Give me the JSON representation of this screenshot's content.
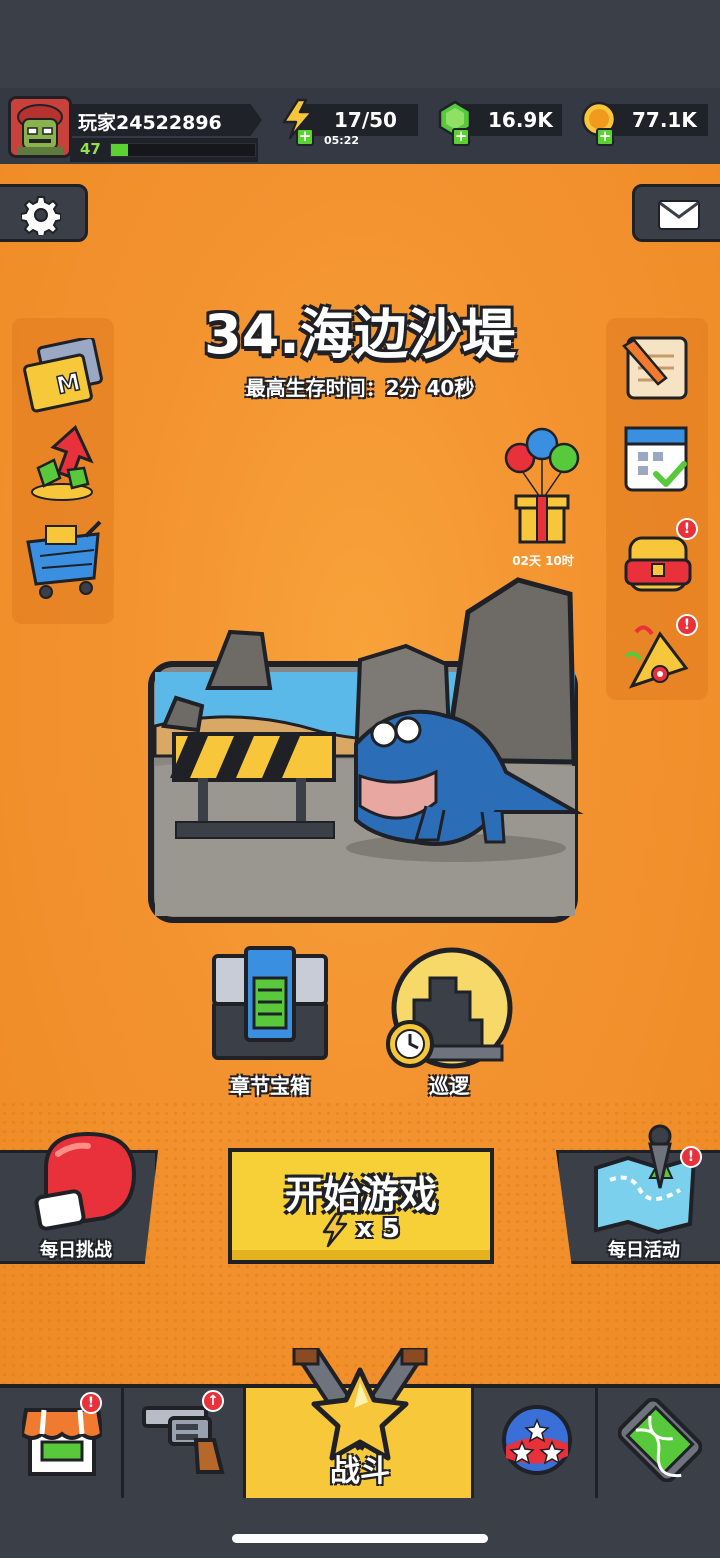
{
  "player": {
    "name": "玩家24522896",
    "level": "47",
    "xp_fraction": 0.12
  },
  "resources": {
    "energy": "17/50",
    "energy_timer": "05:22",
    "gems": "16.9K",
    "coins": "77.1K"
  },
  "stage": {
    "title": "34.海边沙堤",
    "best_time": "最高生存时间：2分 40秒"
  },
  "events": {
    "gift_timer": "02天 10时"
  },
  "modes": {
    "chapter_chest": "章节宝箱",
    "patrol": "巡逻"
  },
  "actions": {
    "start_label": "开始游戏",
    "start_cost": "x 5",
    "daily_challenge": "每日挑战",
    "daily_activity": "每日活动"
  },
  "nav": {
    "battle": "战斗"
  },
  "badges": {
    "alert": "!",
    "upgrade": "↑"
  },
  "colors": {
    "background": "#f0912a",
    "panel": "#3b3f48",
    "outline": "#1f2126",
    "accent_yellow": "#f7d037",
    "xp_green": "#5bd132",
    "badge_red": "#e8313a"
  }
}
